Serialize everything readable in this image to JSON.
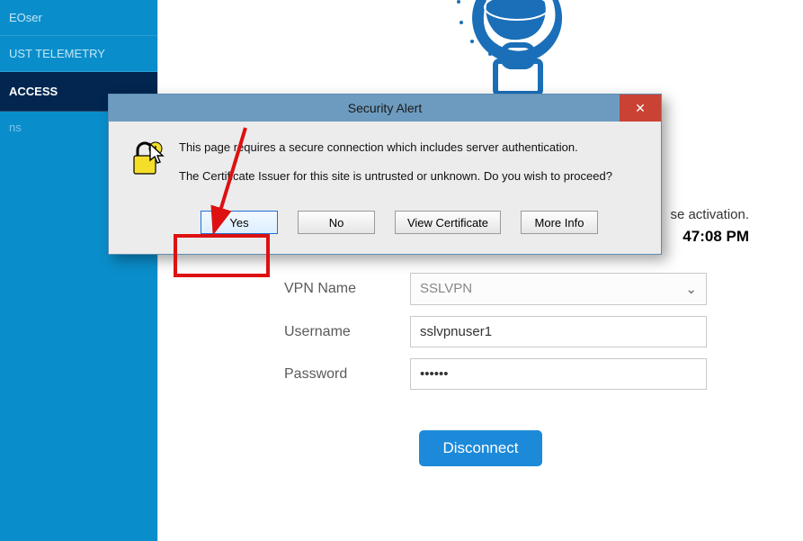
{
  "sidebar": {
    "items": [
      {
        "label": "EOser"
      },
      {
        "label": "UST TELEMETRY"
      },
      {
        "label": "ACCESS"
      }
    ],
    "sub": {
      "label": "ns"
    }
  },
  "status": {
    "text": "se activation.",
    "time": "47:08 PM"
  },
  "form": {
    "vpn_name_label": "VPN Name",
    "vpn_name_value": "SSLVPN",
    "username_label": "Username",
    "username_value": "sslvpnuser1",
    "password_label": "Password",
    "password_value": "••••••"
  },
  "disconnect_label": "Disconnect",
  "dialog": {
    "title": "Security Alert",
    "close": "✕",
    "msg1": "This page requires a secure connection which includes server authentication.",
    "msg2": "The Certificate Issuer for this site is untrusted or unknown.  Do you wish to proceed?",
    "buttons": {
      "yes": "Yes",
      "no": "No",
      "view": "View Certificate",
      "more": "More Info"
    }
  }
}
